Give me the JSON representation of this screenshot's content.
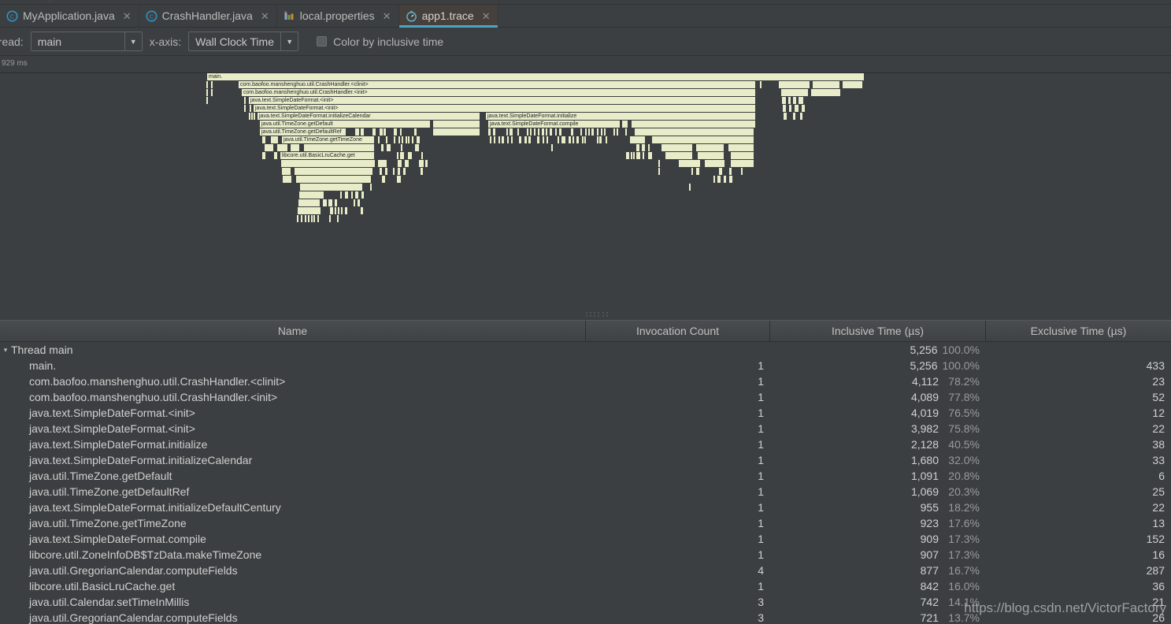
{
  "window": {
    "background": "#3c3f41",
    "top_ghost_text": "..."
  },
  "tabs": [
    {
      "label": "MyApplication.java",
      "icon": "java-class-icon",
      "close": "✕",
      "active": false
    },
    {
      "label": "CrashHandler.java",
      "icon": "java-class-icon",
      "close": "✕",
      "active": false
    },
    {
      "label": "local.properties",
      "icon": "properties-file-icon",
      "close": "✕",
      "active": false
    },
    {
      "label": "app1.trace",
      "icon": "trace-file-icon",
      "close": "✕",
      "active": true
    }
  ],
  "toolbar": {
    "thread_label": "hread:",
    "thread_value": "main",
    "xaxis_label": "x-axis:",
    "xaxis_value": "Wall Clock Time",
    "color_checkbox_label": "Color by inclusive time",
    "color_checkbox_checked": false,
    "dropdown_arrow": "▼"
  },
  "ruler": {
    "tick_label": "929 ms"
  },
  "flame": {
    "accent_color": "#e8ecc8",
    "labels": [
      "main.",
      "com.baofoo.manshenghuo.util.CrashHandler.<clinit>",
      "com.baofoo.manshenghuo.util.CrashHandler.<init>",
      "java.text.SimpleDateFormat.<init>",
      "java.text.SimpleDateFormat.<init>",
      "java.text.SimpleDateFormat.initializeCalendar",
      "java.text.SimpleDateFormat.initialize",
      "java.util.TimeZone.getDefault",
      "java.text.SimpleDateFormat.compile",
      "java.util.TimeZone.getDefaultRef",
      "java.util.TimeZone.getTimeZone",
      "libcore.util.BasicLruCache.get"
    ]
  },
  "table": {
    "columns": [
      "Name",
      "Invocation Count",
      "Inclusive Time (µs)",
      "Exclusive Time (µs)"
    ],
    "rows": [
      {
        "indent": 0,
        "twisty": "▾",
        "name": "Thread main",
        "count": "",
        "inclusive": "5,256",
        "inclusive_pct": "100.0%",
        "exclusive": ""
      },
      {
        "indent": 1,
        "twisty": "",
        "name": "main.",
        "count": "1",
        "inclusive": "5,256",
        "inclusive_pct": "100.0%",
        "exclusive": "433"
      },
      {
        "indent": 1,
        "twisty": "",
        "name": "com.baofoo.manshenghuo.util.CrashHandler.<clinit>",
        "count": "1",
        "inclusive": "4,112",
        "inclusive_pct": "78.2%",
        "exclusive": "23"
      },
      {
        "indent": 1,
        "twisty": "",
        "name": "com.baofoo.manshenghuo.util.CrashHandler.<init>",
        "count": "1",
        "inclusive": "4,089",
        "inclusive_pct": "77.8%",
        "exclusive": "52"
      },
      {
        "indent": 1,
        "twisty": "",
        "name": "java.text.SimpleDateFormat.<init>",
        "count": "1",
        "inclusive": "4,019",
        "inclusive_pct": "76.5%",
        "exclusive": "12"
      },
      {
        "indent": 1,
        "twisty": "",
        "name": "java.text.SimpleDateFormat.<init>",
        "count": "1",
        "inclusive": "3,982",
        "inclusive_pct": "75.8%",
        "exclusive": "22"
      },
      {
        "indent": 1,
        "twisty": "",
        "name": "java.text.SimpleDateFormat.initialize",
        "count": "1",
        "inclusive": "2,128",
        "inclusive_pct": "40.5%",
        "exclusive": "38"
      },
      {
        "indent": 1,
        "twisty": "",
        "name": "java.text.SimpleDateFormat.initializeCalendar",
        "count": "1",
        "inclusive": "1,680",
        "inclusive_pct": "32.0%",
        "exclusive": "33"
      },
      {
        "indent": 1,
        "twisty": "",
        "name": "java.util.TimeZone.getDefault",
        "count": "1",
        "inclusive": "1,091",
        "inclusive_pct": "20.8%",
        "exclusive": "6"
      },
      {
        "indent": 1,
        "twisty": "",
        "name": "java.util.TimeZone.getDefaultRef",
        "count": "1",
        "inclusive": "1,069",
        "inclusive_pct": "20.3%",
        "exclusive": "25"
      },
      {
        "indent": 1,
        "twisty": "",
        "name": "java.text.SimpleDateFormat.initializeDefaultCentury",
        "count": "1",
        "inclusive": "955",
        "inclusive_pct": "18.2%",
        "exclusive": "22"
      },
      {
        "indent": 1,
        "twisty": "",
        "name": "java.util.TimeZone.getTimeZone",
        "count": "1",
        "inclusive": "923",
        "inclusive_pct": "17.6%",
        "exclusive": "13"
      },
      {
        "indent": 1,
        "twisty": "",
        "name": "java.text.SimpleDateFormat.compile",
        "count": "1",
        "inclusive": "909",
        "inclusive_pct": "17.3%",
        "exclusive": "152"
      },
      {
        "indent": 1,
        "twisty": "",
        "name": "libcore.util.ZoneInfoDB$TzData.makeTimeZone",
        "count": "1",
        "inclusive": "907",
        "inclusive_pct": "17.3%",
        "exclusive": "16"
      },
      {
        "indent": 1,
        "twisty": "",
        "name": "java.util.GregorianCalendar.computeFields",
        "count": "4",
        "inclusive": "877",
        "inclusive_pct": "16.7%",
        "exclusive": "287"
      },
      {
        "indent": 1,
        "twisty": "",
        "name": "libcore.util.BasicLruCache.get",
        "count": "1",
        "inclusive": "842",
        "inclusive_pct": "16.0%",
        "exclusive": "36"
      },
      {
        "indent": 1,
        "twisty": "",
        "name": "java.util.Calendar.setTimeInMillis",
        "count": "3",
        "inclusive": "742",
        "inclusive_pct": "14.1%",
        "exclusive": "21"
      },
      {
        "indent": 1,
        "twisty": "",
        "name": "java.util.GregorianCalendar.computeFields",
        "count": "3",
        "inclusive": "721",
        "inclusive_pct": "13.7%",
        "exclusive": "26"
      }
    ]
  },
  "watermark": "https://blog.csdn.net/VictorFactory"
}
